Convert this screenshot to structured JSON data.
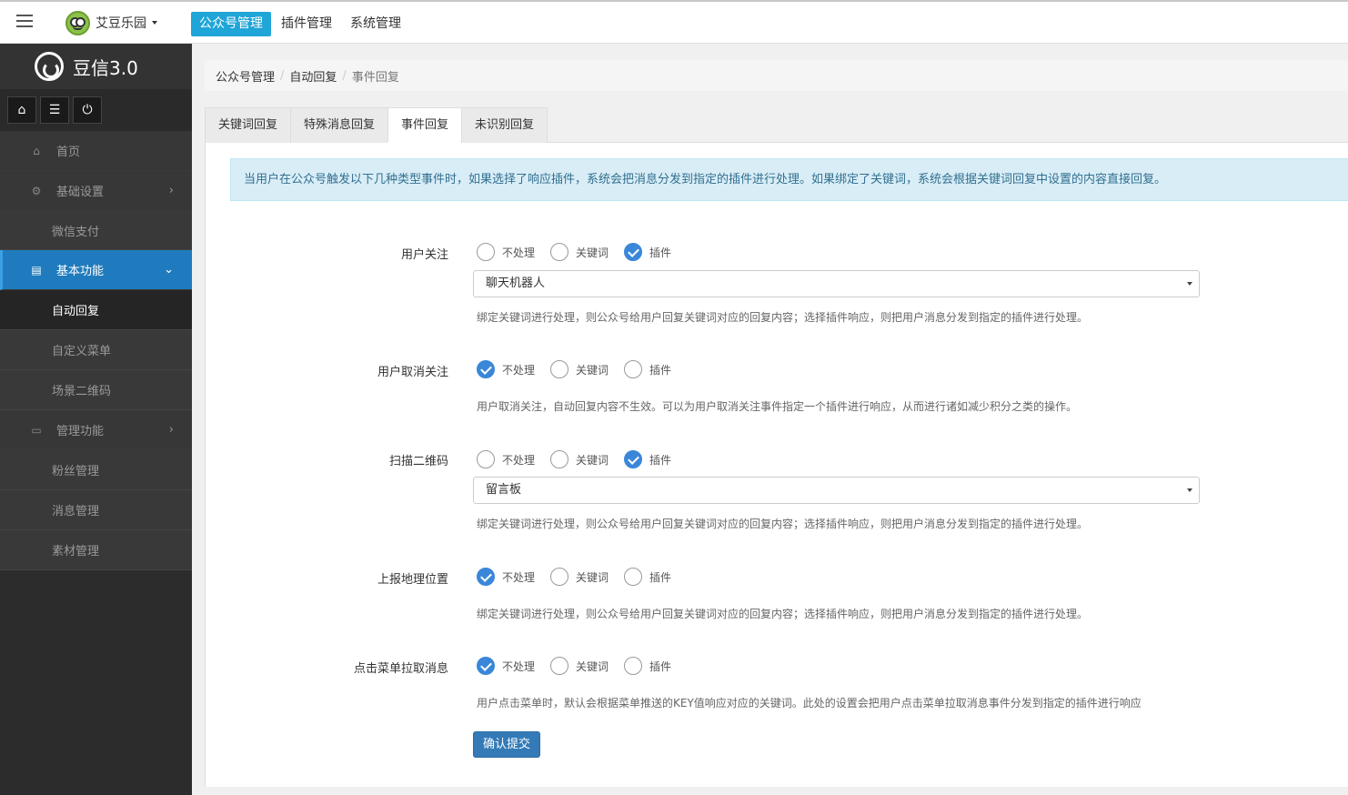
{
  "topbar": {
    "brand": "艾豆乐园",
    "nav": [
      "公众号管理",
      "插件管理",
      "系统管理"
    ]
  },
  "sidebar": {
    "title": "豆信3.0",
    "items": {
      "home": "首页",
      "basic_settings": "基础设置",
      "wechat_pay": "微信支付",
      "basic_features": "基本功能",
      "auto_reply": "自动回复",
      "custom_menu": "自定义菜单",
      "scene_qrcode": "场景二维码",
      "management": "管理功能",
      "fans": "粉丝管理",
      "messages": "消息管理",
      "materials": "素材管理"
    }
  },
  "breadcrumb": [
    "公众号管理",
    "自动回复",
    "事件回复"
  ],
  "tabs": [
    "关键词回复",
    "特殊消息回复",
    "事件回复",
    "未识别回复"
  ],
  "alert": "当用户在公众号触发以下几种类型事件时，如果选择了响应插件，系统会把消息分发到指定的插件进行处理。如果绑定了关键词，系统会根据关键词回复中设置的内容直接回复。",
  "options": [
    "不处理",
    "关键词",
    "插件"
  ],
  "fields": [
    {
      "label": "用户关注",
      "selected": "插件",
      "select_value": "聊天机器人",
      "help": "绑定关键词进行处理，则公众号给用户回复关键词对应的回复内容；选择插件响应，则把用户消息分发到指定的插件进行处理。"
    },
    {
      "label": "用户取消关注",
      "selected": "不处理",
      "help": "用户取消关注，自动回复内容不生效。可以为用户取消关注事件指定一个插件进行响应，从而进行诸如减少积分之类的操作。"
    },
    {
      "label": "扫描二维码",
      "selected": "插件",
      "select_value": "留言板",
      "help": "绑定关键词进行处理，则公众号给用户回复关键词对应的回复内容；选择插件响应，则把用户消息分发到指定的插件进行处理。"
    },
    {
      "label": "上报地理位置",
      "selected": "不处理",
      "help": "绑定关键词进行处理，则公众号给用户回复关键词对应的回复内容；选择插件响应，则把用户消息分发到指定的插件进行处理。"
    },
    {
      "label": "点击菜单拉取消息",
      "selected": "不处理",
      "help": "用户点击菜单时，默认会根据菜单推送的KEY值响应对应的关键词。此处的设置会把用户点击菜单拉取消息事件分发到指定的插件进行响应"
    }
  ],
  "submit": "确认提交"
}
